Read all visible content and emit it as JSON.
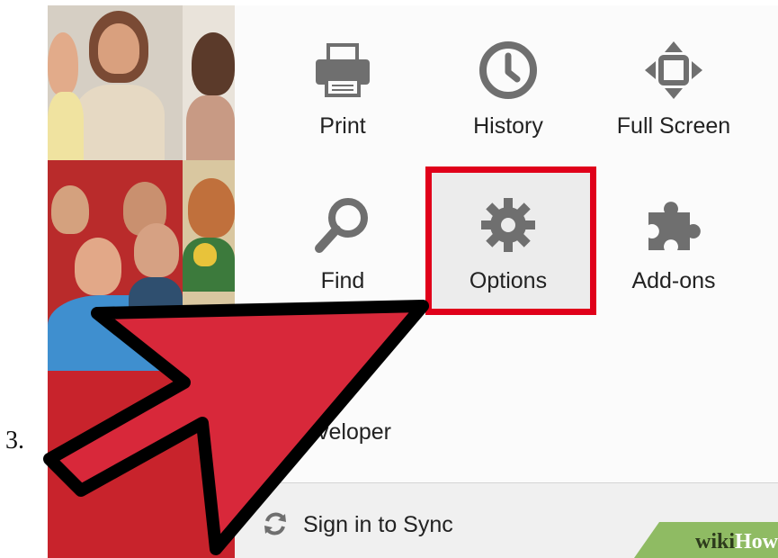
{
  "step": {
    "number": "3."
  },
  "menu": {
    "items": [
      {
        "label": "Print",
        "icon": "printer-icon"
      },
      {
        "label": "History",
        "icon": "clock-icon"
      },
      {
        "label": "Full Screen",
        "icon": "fullscreen-icon"
      },
      {
        "label": "Find",
        "icon": "magnifier-icon"
      },
      {
        "label": "Options",
        "icon": "gear-icon"
      },
      {
        "label": "Add-ons",
        "icon": "puzzle-icon"
      }
    ],
    "developer_label": "veloper",
    "sync_label": "Sign in to Sync"
  },
  "watermark": {
    "wiki": "wiki",
    "how": "How"
  },
  "colors": {
    "highlight": "#e0001a",
    "arrow_fill": "#d8283a",
    "arrow_outline": "#000000",
    "icon_gray": "#6f6f6f",
    "panel_bg": "#fbfbfb"
  }
}
